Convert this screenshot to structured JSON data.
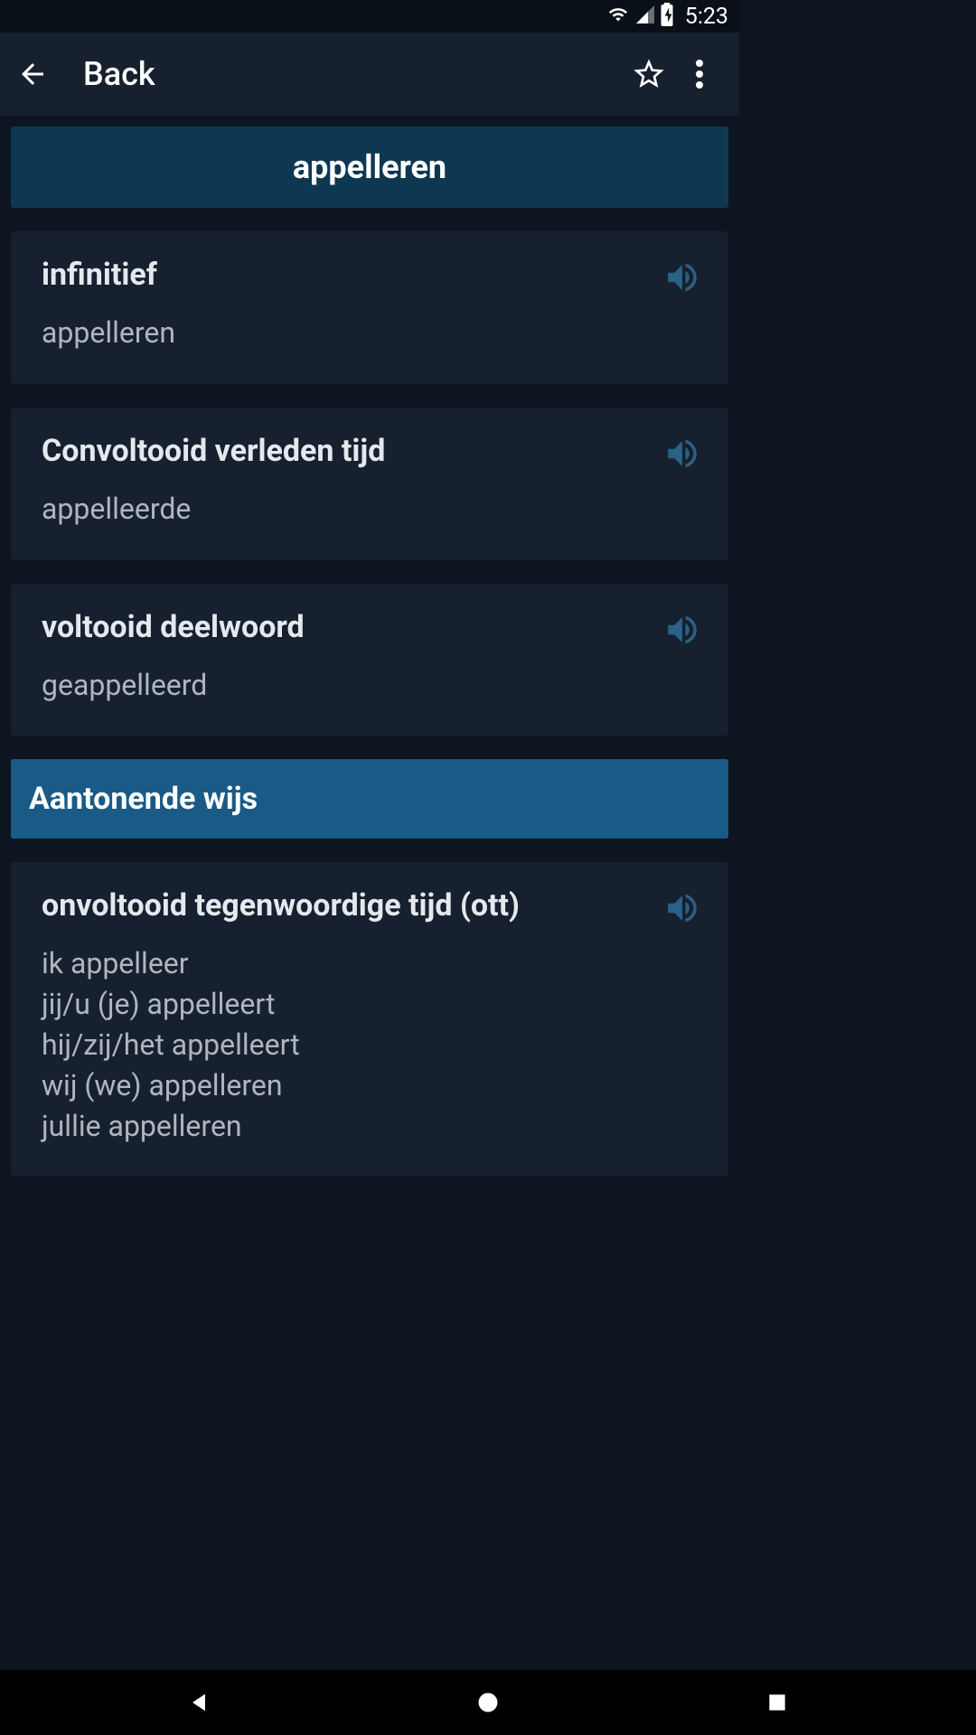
{
  "status": {
    "time": "5:23"
  },
  "appBar": {
    "title": "Back"
  },
  "word": "appelleren",
  "cards": [
    {
      "title": "infinitief",
      "value": "appelleren"
    },
    {
      "title": "Convoltooid verleden tijd",
      "value": "appelleerde"
    },
    {
      "title": "voltooid deelwoord",
      "value": "geappelleerd"
    }
  ],
  "section": {
    "title": "Aantonende wijs"
  },
  "conjugation": {
    "title": "onvoltooid tegenwoordige tijd (ott)",
    "lines": "ik appelleer\njij/u (je) appelleert\nhij/zij/het appelleert\nwij (we) appelleren\njullie appelleren"
  }
}
